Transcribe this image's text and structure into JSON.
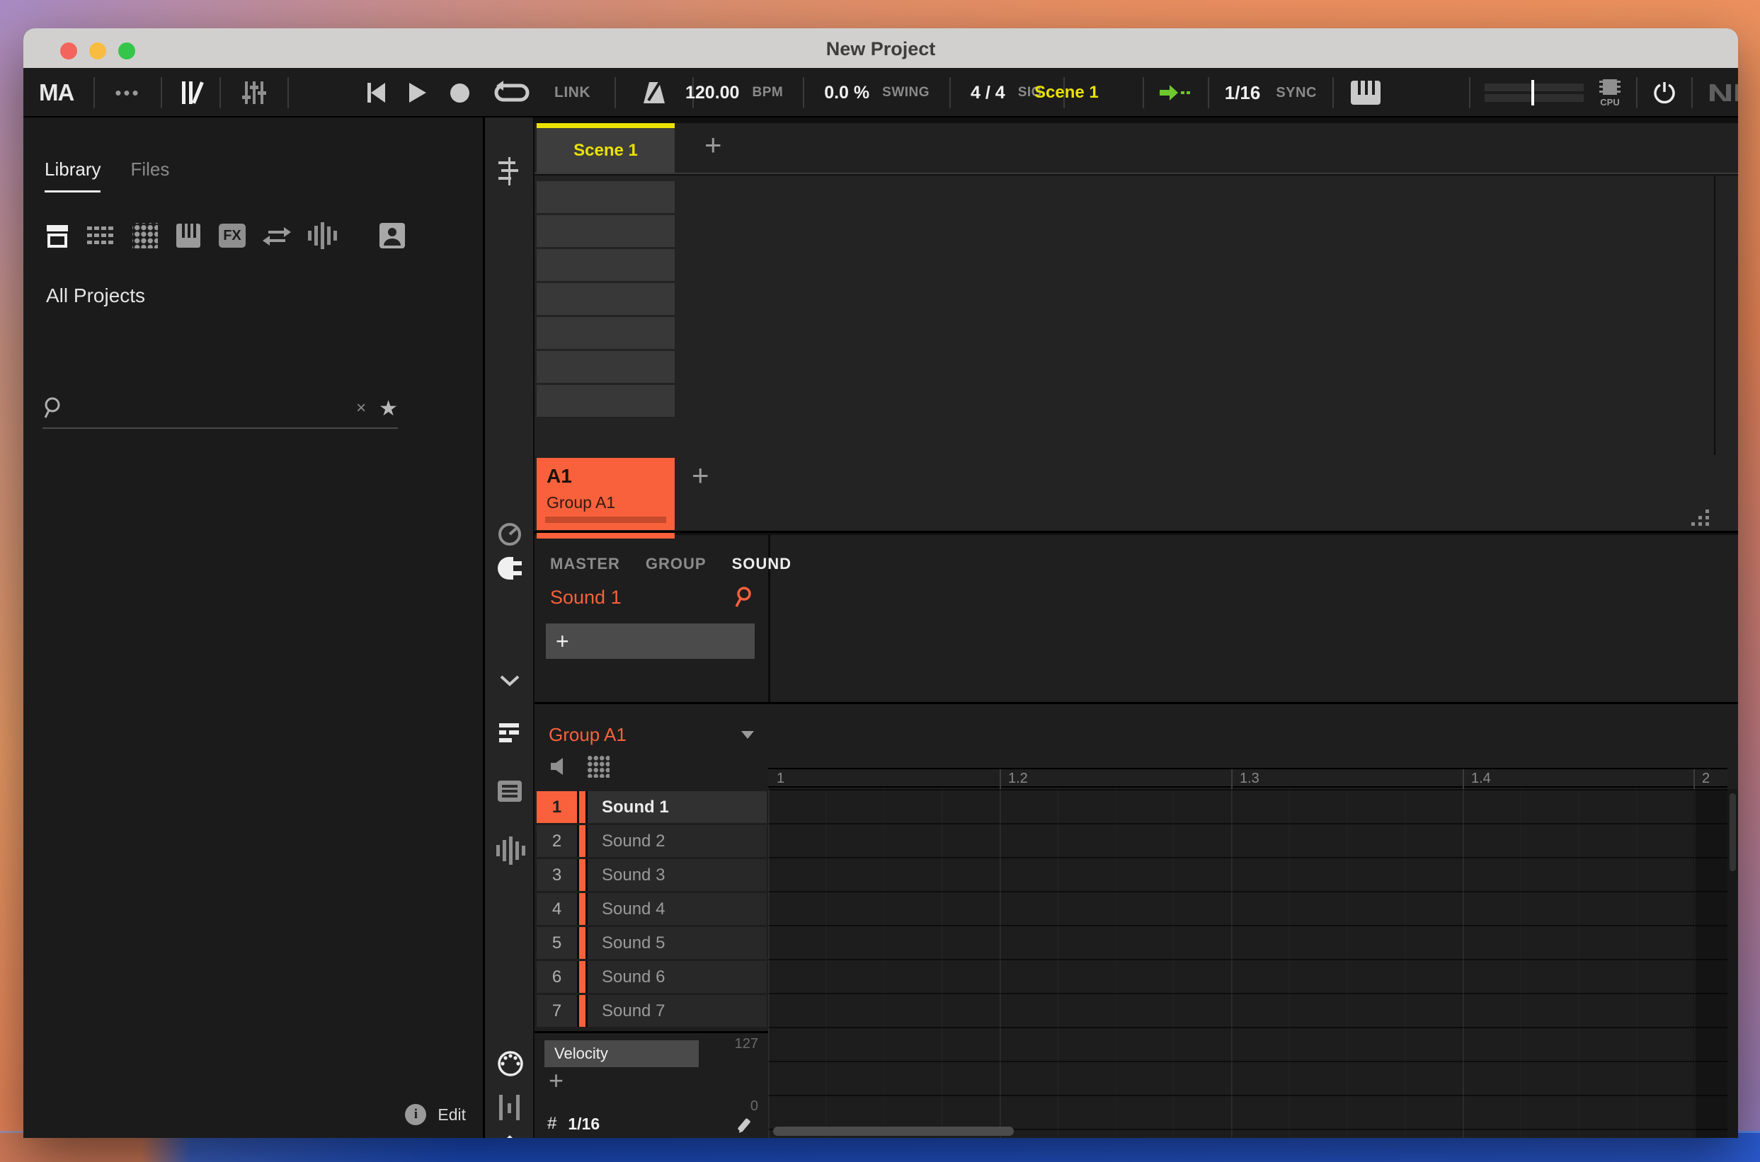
{
  "window": {
    "title": "New Project"
  },
  "colors": {
    "orange": "#f8613c",
    "yellow": "#eae200",
    "green": "#6fc72f"
  },
  "icons": {
    "plus": "+",
    "dots_menu": "•••",
    "clear": "×",
    "star": "★",
    "grid_glyph": "#",
    "info": "i"
  },
  "toolbar": {
    "logo": "MA",
    "link": "LINK",
    "bpm": {
      "value": "120.00",
      "label": "BPM"
    },
    "swing": {
      "value": "0.0 %",
      "label": "SWING"
    },
    "sig": {
      "value": "4  /  4",
      "label": "SIG"
    },
    "scene": "Scene 1",
    "grid": {
      "value": "1/16",
      "label": "SYNC"
    },
    "cpu": "CPU"
  },
  "browser": {
    "tabs": [
      {
        "label": "Library"
      },
      {
        "label": "Files"
      }
    ],
    "heading": "All Projects",
    "search_placeholder": "",
    "edit": "Edit"
  },
  "arranger": {
    "scene_tab": "Scene 1",
    "group_id": "A1",
    "group_name": "Group A1"
  },
  "control": {
    "tabs": [
      {
        "label": "MASTER"
      },
      {
        "label": "GROUP"
      },
      {
        "label": "SOUND"
      }
    ],
    "active_tab": "SOUND",
    "sound_name": "Sound 1"
  },
  "pattern": {
    "group_name": "Group A1",
    "sounds": [
      {
        "num": "1",
        "name": "Sound 1"
      },
      {
        "num": "2",
        "name": "Sound 2"
      },
      {
        "num": "3",
        "name": "Sound 3"
      },
      {
        "num": "4",
        "name": "Sound 4"
      },
      {
        "num": "5",
        "name": "Sound 5"
      },
      {
        "num": "6",
        "name": "Sound 6"
      },
      {
        "num": "7",
        "name": "Sound 7"
      }
    ],
    "ruler": [
      "1",
      "1.2",
      "1.3",
      "1.4",
      "2"
    ],
    "lane": {
      "name": "Velocity",
      "max": "127",
      "min": "0",
      "step": "1/16"
    }
  }
}
